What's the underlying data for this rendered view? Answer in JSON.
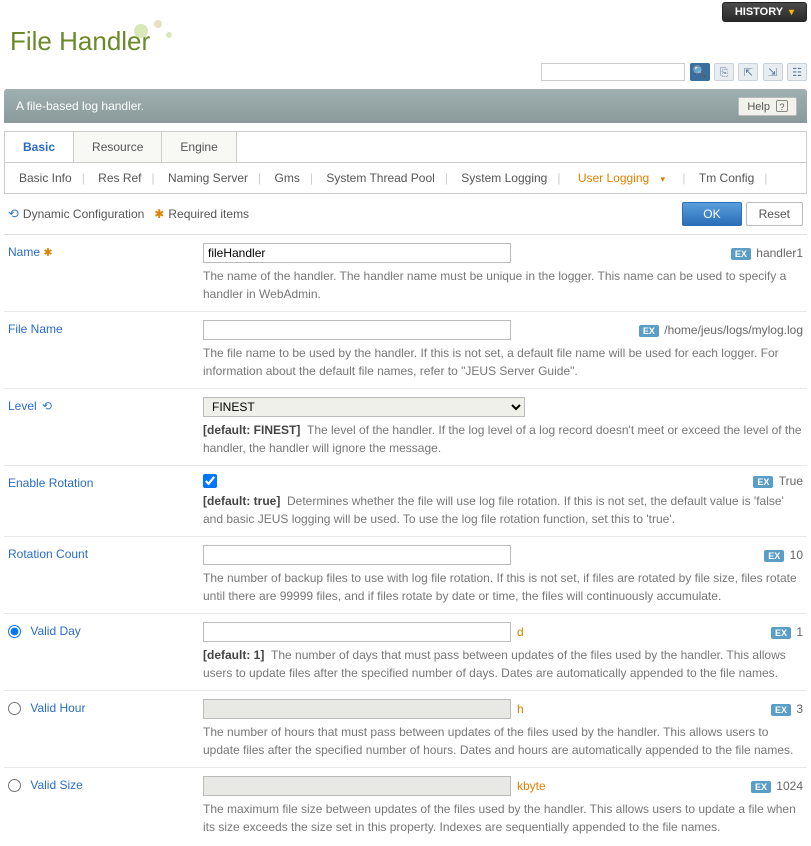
{
  "topbar": {
    "history": "HISTORY"
  },
  "header": {
    "title": "File Handler",
    "description": "A file-based log handler.",
    "help": "Help"
  },
  "tabs": [
    "Basic",
    "Resource",
    "Engine"
  ],
  "subnav": [
    "Basic Info",
    "Res Ref",
    "Naming Server",
    "Gms",
    "System Thread Pool",
    "System Logging",
    "User Logging",
    "Tm Config"
  ],
  "config": {
    "dynamic": "Dynamic Configuration",
    "required": "Required items",
    "ok": "OK",
    "reset": "Reset"
  },
  "fields": {
    "name": {
      "label": "Name",
      "value": "fileHandler",
      "example": "handler1",
      "desc": "The name of the handler. The handler name must be unique in the logger. This name can be used to specify a handler in WebAdmin."
    },
    "file_name": {
      "label": "File Name",
      "example": "/home/jeus/logs/mylog.log",
      "desc": "The file name to be used by the handler. If this is not set, a default file name will be used for each logger. For information about the default file names, refer to \"JEUS Server Guide\"."
    },
    "level": {
      "label": "Level",
      "value": "FINEST",
      "default_label": "[default: FINEST]",
      "desc": "The level of the handler. If the log level of a log record doesn't meet or exceed the level of the handler, the handler will ignore the message."
    },
    "enable_rotation": {
      "label": "Enable Rotation",
      "example": "True",
      "default_label": "[default: true]",
      "desc": "Determines whether the file will use log file rotation. If this is not set, the default value is 'false' and basic JEUS logging will be used. To use the log file rotation function, set this to 'true'."
    },
    "rotation_count": {
      "label": "Rotation Count",
      "example": "10",
      "desc": "The number of backup files to use with log file rotation. If this is not set, if files are rotated by file size, files rotate until there are 99999 files, and if files rotate by date or time, the files will continuously accumulate."
    },
    "valid_day": {
      "label": "Valid Day",
      "unit": "d",
      "example": "1",
      "default_label": "[default: 1]",
      "desc": "The number of days that must pass between updates of the files used by the handler. This allows users to update files after the specified number of days. Dates are automatically appended to the file names."
    },
    "valid_hour": {
      "label": "Valid Hour",
      "unit": "h",
      "example": "3",
      "desc": "The number of hours that must pass between updates of the files used by the handler. This allows users to update files after the specified number of hours. Dates and hours are automatically appended to the file names."
    },
    "valid_size": {
      "label": "Valid Size",
      "unit": "kbyte",
      "example": "1024",
      "desc": "The maximum file size between updates of the files used by the handler. This allows users to update a file when its size exceeds the size set in this property. Indexes are sequentially appended to the file names."
    }
  }
}
